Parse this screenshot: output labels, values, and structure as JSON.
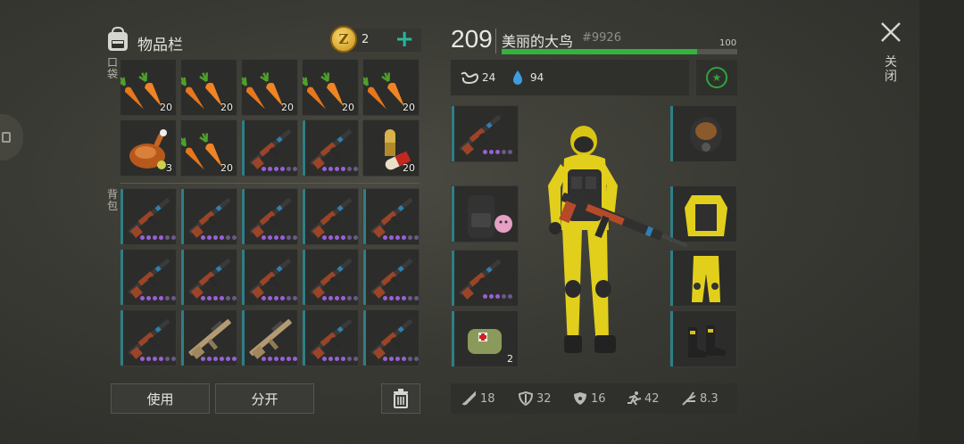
{
  "inventory": {
    "title": "物品栏",
    "coins": "2",
    "pocket_label": "口袋",
    "backpack_label": "背包",
    "pocket": [
      {
        "item": "carrot",
        "count": "20"
      },
      {
        "item": "carrot",
        "count": "20"
      },
      {
        "item": "carrot",
        "count": "20"
      },
      {
        "item": "carrot",
        "count": "20"
      },
      {
        "item": "carrot",
        "count": "20"
      },
      {
        "item": "roast-chicken",
        "count": "3"
      },
      {
        "item": "carrot",
        "count": "20"
      },
      {
        "item": "rifle",
        "count": ""
      },
      {
        "item": "rifle",
        "count": ""
      },
      {
        "item": "pills",
        "count": "20"
      }
    ],
    "backpack": [
      {
        "item": "rifle"
      },
      {
        "item": "rifle"
      },
      {
        "item": "rifle"
      },
      {
        "item": "rifle"
      },
      {
        "item": "rifle"
      },
      {
        "item": "rifle"
      },
      {
        "item": "rifle"
      },
      {
        "item": "rifle"
      },
      {
        "item": "rifle"
      },
      {
        "item": "rifle"
      },
      {
        "item": "rifle"
      },
      {
        "item": "scar"
      },
      {
        "item": "scar"
      },
      {
        "item": "rifle"
      },
      {
        "item": "rifle"
      }
    ],
    "use_label": "使用",
    "split_label": "分开"
  },
  "player": {
    "level": "209",
    "name": "美丽的大鸟",
    "id": "#9926",
    "hp_max": "100",
    "hp_fraction": 0.83,
    "hunger": "24",
    "thirst": "94"
  },
  "equipment": {
    "left": [
      {
        "item": "rifle",
        "count": ""
      },
      {
        "item": "backpack",
        "count": ""
      },
      {
        "item": "rifle",
        "count": ""
      },
      {
        "item": "medkit",
        "count": "2"
      }
    ],
    "right": [
      {
        "item": "gas-mask"
      },
      {
        "item": "vest"
      },
      {
        "item": "pants"
      },
      {
        "item": "boots"
      }
    ]
  },
  "armor": [
    {
      "icon": "sword-icon",
      "value": "18"
    },
    {
      "icon": "shield-icon",
      "value": "32"
    },
    {
      "icon": "hazard-shield-icon",
      "value": "16"
    },
    {
      "icon": "running-icon",
      "value": "42"
    },
    {
      "icon": "stealth-icon",
      "value": "8.3"
    }
  ],
  "close_label": "关闭",
  "colors": {
    "accent": "#25b89a",
    "hp": "#34b33f",
    "rarity": "#2e7f86",
    "dots": "#9a5fd8"
  }
}
